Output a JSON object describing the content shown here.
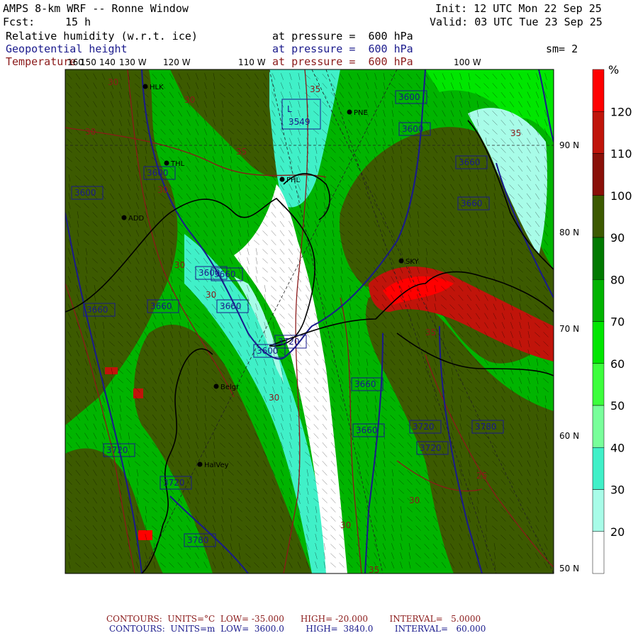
{
  "header": {
    "title": "AMPS 8-km WRF -- Ronne Window",
    "fcst_label": "Fcst:",
    "fcst_value": "15 h",
    "init": "Init: 12 UTC Mon 22 Sep 25",
    "valid": "Valid: 03 UTC Tue 23 Sep 25",
    "fields": [
      {
        "name": "Relative humidity (w.r.t. ice)",
        "level": "at pressure =  600 hPa"
      },
      {
        "name": "Geopotential height",
        "level": "at pressure =  600 hPa",
        "extra": "sm= 2"
      },
      {
        "name": "Temperature",
        "level": "at pressure =  600 hPa"
      }
    ]
  },
  "longitude_labels": [
    "160",
    "150",
    "140",
    "130 W",
    "120 W",
    "110 W",
    "100 W"
  ],
  "latitude_labels": [
    "90 N",
    "80 N",
    "70 N",
    "60 N",
    "50 N"
  ],
  "stations": [
    "HLK",
    "THL",
    "PHL",
    "ADD",
    "PNE",
    "SKY",
    "Belgr",
    "HalVey"
  ],
  "height_labels": [
    "3600",
    "3600",
    "3660",
    "3600",
    "3600",
    "3600",
    "3660",
    "3720",
    "3660",
    "3660",
    "3660",
    "3660",
    "3660",
    "3720",
    "3720",
    "3720",
    "3780",
    "3720",
    "3780",
    "3660",
    "3600"
  ],
  "temp_labels": [
    "30",
    "35",
    "30",
    "35",
    "30",
    "30",
    "30",
    "25",
    "30",
    "30",
    "30",
    "35",
    "35",
    "30",
    "35"
  ],
  "low_center": {
    "label": "L",
    "value": "3549"
  },
  "colorbar": {
    "unit": "%",
    "levels": [
      "120",
      "110",
      "100",
      "90",
      "80",
      "70",
      "60",
      "50",
      "40",
      "30",
      "20"
    ],
    "colors": [
      "#ff0000",
      "#c0140a",
      "#8a1008",
      "#3c5a00",
      "#007a00",
      "#00b400",
      "#00e600",
      "#3cff3c",
      "#78ff9a",
      "#40f0c8",
      "#a8fce8",
      "#ffffff"
    ]
  },
  "colors": {
    "dark_olive": "#3c5a00",
    "temp_contour": "#8b1a1a",
    "height_contour": "#1a1a8c"
  },
  "footer": {
    "temp_contours": {
      "prefix": "CONTOURS:",
      "units": "UNITS=°C",
      "low": "LOW= -35.000",
      "high": "HIGH= -20.000",
      "interval": "INTERVAL=   5.0000"
    },
    "height_contours": {
      "prefix": "CONTOURS:",
      "units": "UNITS=m",
      "low": "LOW=  3600.0",
      "high": "HIGH=  3840.0",
      "interval": "INTERVAL=   60.000"
    }
  }
}
